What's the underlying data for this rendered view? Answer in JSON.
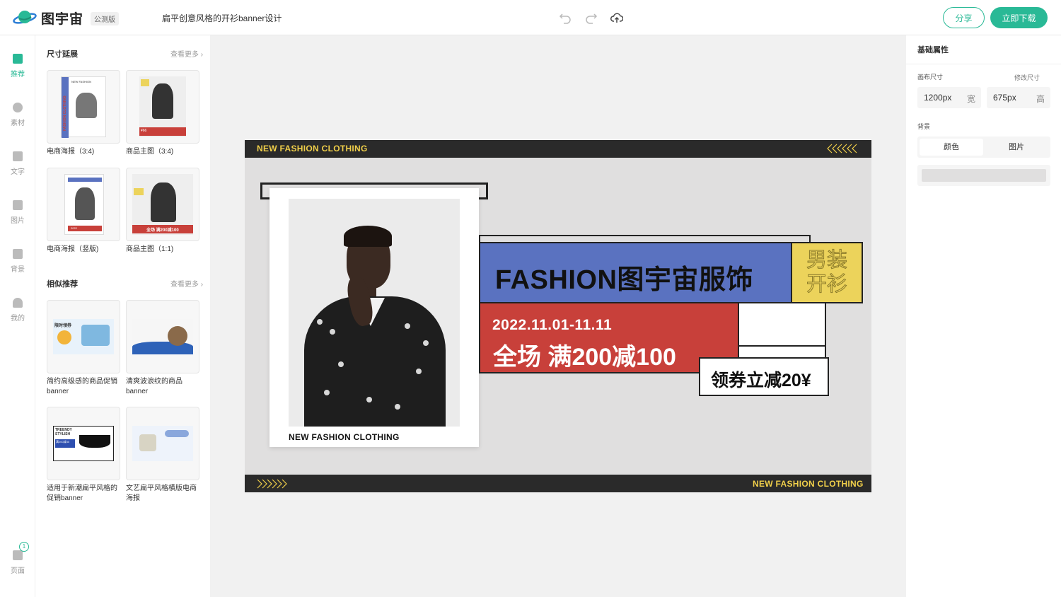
{
  "topbar": {
    "logo_text": "图宇宙",
    "beta_badge": "公测版",
    "doc_title": "扁平创意风格的开衫banner设计",
    "share_label": "分享",
    "download_label": "立即下载"
  },
  "leftnav": {
    "items": [
      {
        "label": "推荐"
      },
      {
        "label": "素材"
      },
      {
        "label": "文字"
      },
      {
        "label": "图片"
      },
      {
        "label": "背景"
      },
      {
        "label": "我的"
      }
    ],
    "pages_label": "页面",
    "pages_count": "1"
  },
  "panel": {
    "size_ext_title": "尺寸延展",
    "similar_title": "相似推荐",
    "more_label": "查看更多",
    "size_items": [
      {
        "caption": "电商海报（3:4)"
      },
      {
        "caption": "商品主图（3:4)"
      },
      {
        "caption": "电商海报（竖版)"
      },
      {
        "caption": "商品主图（1:1)"
      }
    ],
    "similar_items": [
      {
        "caption": "简约高级感的商品促销banner"
      },
      {
        "caption": "清爽波浪纹的商品banner"
      },
      {
        "caption": "适用于新潮扁平风格的促销banner"
      },
      {
        "caption": "文艺扁平风格横版电商海报"
      }
    ],
    "thumb_texts": {
      "poster_side": "FASHION CLOTHING",
      "poster_head": "NEW FASHION",
      "price": "¥66",
      "promo": "全场 满200减100",
      "promo_short": "满200减30",
      "limited": "限时领券",
      "trendy": "TREENDY STYLISH",
      "year": "2022"
    }
  },
  "rightpanel": {
    "title": "基础属性",
    "canvas_size_label": "画布尺寸",
    "modify_size_label": "修改尺寸",
    "width_value": "1200px",
    "width_unit": "宽",
    "height_value": "675px",
    "height_unit": "高",
    "background_label": "背景",
    "bg_tab_color": "颜色",
    "bg_tab_image": "图片"
  },
  "banner": {
    "top_strip_text": "NEW FASHION CLOTHING",
    "bottom_strip_text": "NEW FASHION CLOTHING",
    "photo_caption": "NEW FASHION CLOTHING",
    "headline": "FASHION图宇宙服饰",
    "tag_line1": "男装",
    "tag_line2": "开衫",
    "date_range": "2022.11.01-11.11",
    "promo_text": "全场 满200减100",
    "coupon_text": "领券立减20¥"
  },
  "colors": {
    "accent": "#29b996",
    "banner_blue": "#5a72c0",
    "banner_red": "#c8403a",
    "banner_yellow": "#ecd35b",
    "strip_dark": "#2a2a2a",
    "strip_text": "#f0cf4a"
  }
}
